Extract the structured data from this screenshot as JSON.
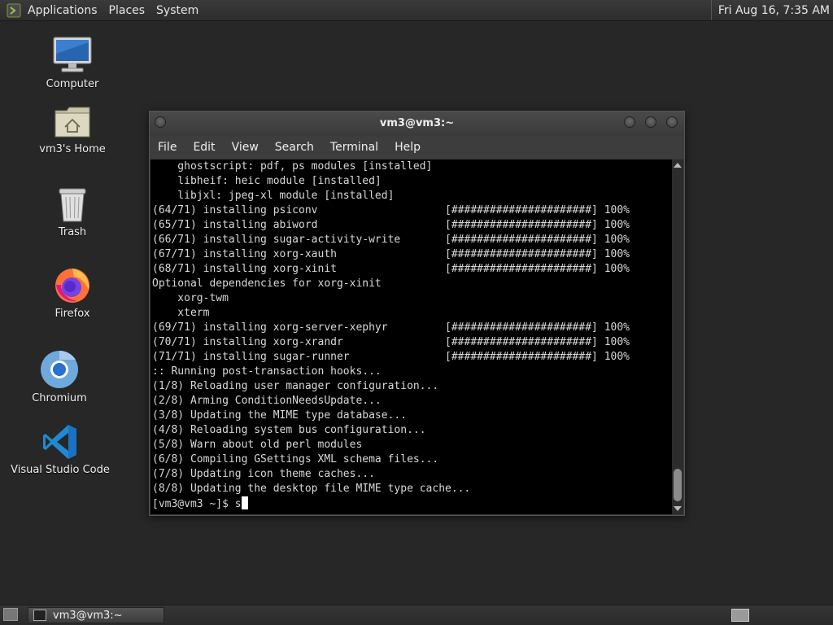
{
  "top_panel": {
    "menus": [
      "Applications",
      "Places",
      "System"
    ],
    "clock": "Fri Aug 16,  7:35 AM"
  },
  "desktop": {
    "icons": [
      {
        "label": "Computer",
        "icon": "computer-icon"
      },
      {
        "label": "vm3's Home",
        "icon": "home-folder-icon"
      },
      {
        "label": "Trash",
        "icon": "trash-icon"
      },
      {
        "label": "Firefox",
        "icon": "firefox-icon"
      },
      {
        "label": "Chromium",
        "icon": "chromium-icon"
      },
      {
        "label": "Visual Studio Code",
        "icon": "vscode-icon"
      }
    ]
  },
  "window": {
    "title": "vm3@vm3:~",
    "menu": [
      "File",
      "Edit",
      "View",
      "Search",
      "Terminal",
      "Help"
    ],
    "terminal_lines": [
      "    ghostscript: pdf, ps modules [installed]",
      "    libheif: heic module [installed]",
      "    libjxl: jpeg-xl module [installed]",
      "(64/71) installing psiconv                    [######################] 100%",
      "(65/71) installing abiword                    [######################] 100%",
      "(66/71) installing sugar-activity-write       [######################] 100%",
      "(67/71) installing xorg-xauth                 [######################] 100%",
      "(68/71) installing xorg-xinit                 [######################] 100%",
      "Optional dependencies for xorg-xinit",
      "    xorg-twm",
      "    xterm",
      "(69/71) installing xorg-server-xephyr         [######################] 100%",
      "(70/71) installing xorg-xrandr                [######################] 100%",
      "(71/71) installing sugar-runner               [######################] 100%",
      ":: Running post-transaction hooks...",
      "(1/8) Reloading user manager configuration...",
      "(2/8) Arming ConditionNeedsUpdate...",
      "(3/8) Updating the MIME type database...",
      "(4/8) Reloading system bus configuration...",
      "(5/8) Warn about old perl modules",
      "(6/8) Compiling GSettings XML schema files...",
      "(7/8) Updating icon theme caches...",
      "(8/8) Updating the desktop file MIME type cache..."
    ],
    "prompt": "[vm3@vm3 ~]$ ",
    "input": "s"
  },
  "taskbar": {
    "task_label": "vm3@vm3:~"
  }
}
